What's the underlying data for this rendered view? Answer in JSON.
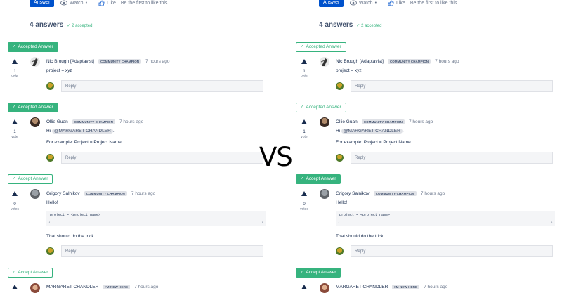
{
  "toolbar": {
    "answer_label": "Answer",
    "watch_label": "Watch",
    "like_label": "Like",
    "like_prompt": "Be the first to like this"
  },
  "summary": {
    "answers_count": "4 answers",
    "accepted_count": "2 accepted"
  },
  "buttons": {
    "accepted": "Accepted Answer",
    "accept": "Accept Answer"
  },
  "reply_placeholder": "Reply",
  "vote_label_single": "vote",
  "vote_label_plural": "votes",
  "vs_label": "VS",
  "answers": [
    {
      "author": "Nic Brough [Adaptavist]",
      "badge": "COMMUNITY CHAMPION",
      "time": "7 hours ago",
      "votes": "1",
      "body": "project = xyz"
    },
    {
      "author": "Ollie Guan",
      "badge": "COMMUNITY CHAMPION",
      "time": "7 hours ago",
      "votes": "1",
      "body_prefix": "Hi",
      "mention": "@MARGARET CHANDLER",
      "body_suffix": ".",
      "body2": "For example: Project = Project Name"
    },
    {
      "author": "Grigory Salnikov",
      "badge": "COMMUNITY CHAMPION",
      "time": "7 hours ago",
      "votes": "0",
      "body": "Hello!",
      "code": "project = <project name>",
      "body2": "That should do the trick."
    },
    {
      "author": "MARGARET CHANDLER",
      "badge": "I'M NEW HERE",
      "time": "7 hours ago"
    }
  ],
  "colors": {
    "accent": "#0052cc",
    "accept_green": "#36b37e",
    "text": "#172b4d",
    "muted": "#6b778c"
  },
  "icons": [
    "eye-icon",
    "thumbs-up-icon",
    "check-icon",
    "upvote-arrow-icon",
    "more-icon",
    "scroll-left-icon",
    "scroll-right-icon"
  ]
}
